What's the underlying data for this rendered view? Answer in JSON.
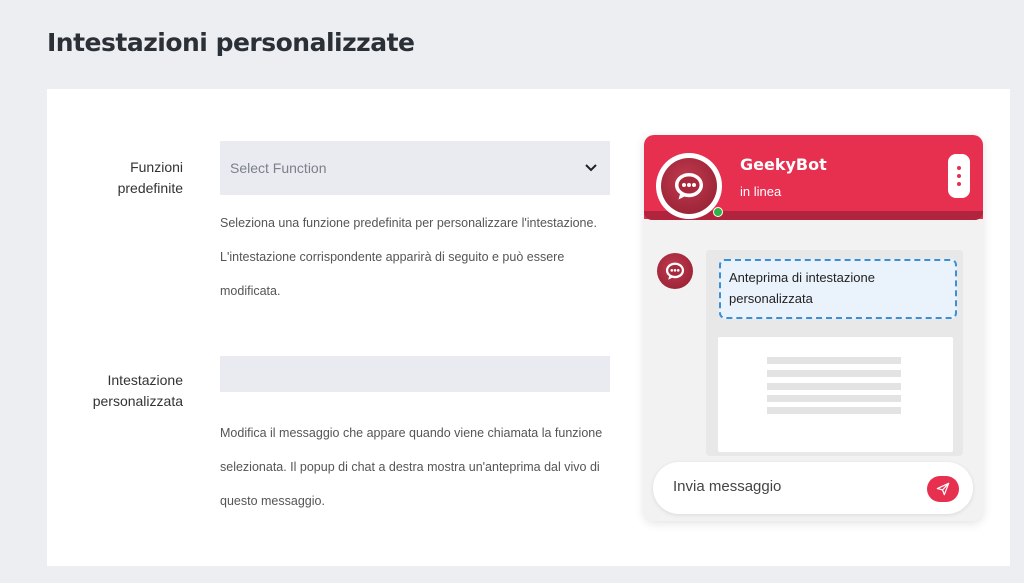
{
  "page": {
    "title": "Intestazioni personalizzate"
  },
  "form": {
    "functions": {
      "label_line1": "Funzioni",
      "label_line2": "predefinite",
      "selected": "Select Function",
      "help": [
        "Seleziona una funzione predefinita per personalizzare l'intestazione.",
        "L'intestazione corrispondente apparirà di seguito e può essere",
        "modificata."
      ]
    },
    "custom_header": {
      "label_line1": "Intestazione",
      "label_line2": "personalizzata",
      "value": "",
      "help": [
        "Modifica il messaggio che appare quando viene chiamata la funzione",
        "selezionata. Il popup di chat a destra mostra un'anteprima dal vivo di",
        "questo messaggio."
      ]
    }
  },
  "chat": {
    "bot_name": "GeekyBot",
    "status": "in linea",
    "preview_line1": "Anteprima di intestazione",
    "preview_line2": "personalizzata",
    "input_placeholder": "Invia messaggio",
    "colors": {
      "brand": "#e72f4f",
      "brand_dark": "#b0243d",
      "online": "#2fb344",
      "preview_border": "#3a8fd6"
    },
    "icons": {
      "avatar": "chat-bubble-icon",
      "menu": "kebab-menu-icon",
      "send": "paper-plane-icon"
    }
  }
}
